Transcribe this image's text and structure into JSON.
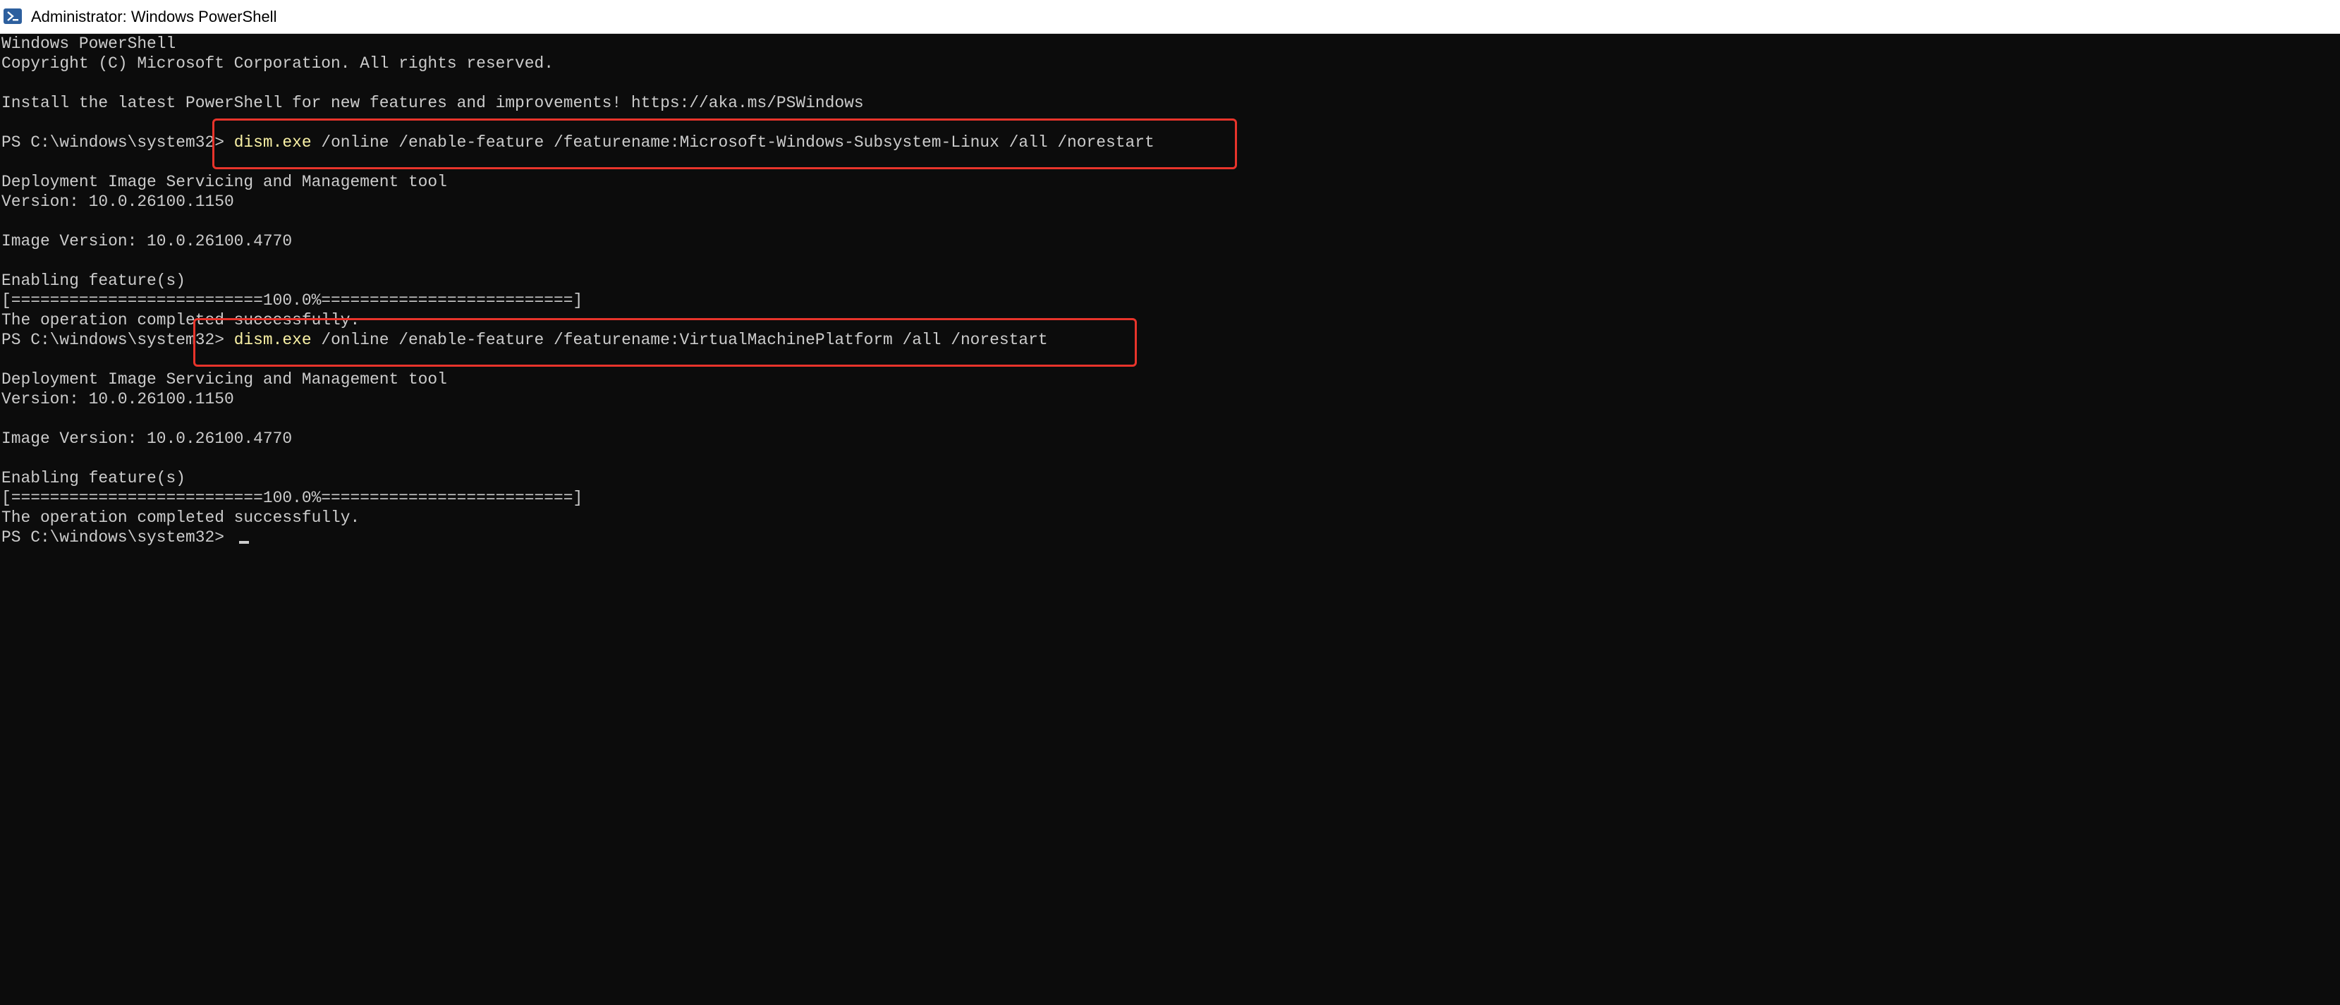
{
  "window": {
    "title": "Administrator: Windows PowerShell"
  },
  "console": {
    "banner": [
      "Windows PowerShell",
      "Copyright (C) Microsoft Corporation. All rights reserved.",
      "",
      "Install the latest PowerShell for new features and improvements! https://aka.ms/PSWindows"
    ],
    "prompt": "PS C:\\windows\\system32> ",
    "command1": {
      "exe": "dism.exe",
      "args": " /online /enable-feature /featurename:Microsoft-Windows-Subsystem-Linux /all /norestart"
    },
    "output1": [
      "Deployment Image Servicing and Management tool",
      "Version: 10.0.26100.1150",
      "",
      "Image Version: 10.0.26100.4770",
      "",
      "Enabling feature(s)",
      "[==========================100.0%==========================]",
      "The operation completed successfully."
    ],
    "command2": {
      "exe": "dism.exe",
      "args": " /online /enable-feature /featurename:VirtualMachinePlatform /all /norestart"
    },
    "output2": [
      "Deployment Image Servicing and Management tool",
      "Version: 10.0.26100.1150",
      "",
      "Image Version: 10.0.26100.4770",
      "",
      "Enabling feature(s)",
      "[==========================100.0%==========================]",
      "The operation completed successfully."
    ],
    "final_prompt": "PS C:\\windows\\system32> "
  },
  "colors": {
    "background": "#0c0c0c",
    "text": "#cccccc",
    "command": "#f9f1a5",
    "highlight_box": "#e8342b"
  },
  "icons": {
    "window_icon": "powershell-icon"
  }
}
